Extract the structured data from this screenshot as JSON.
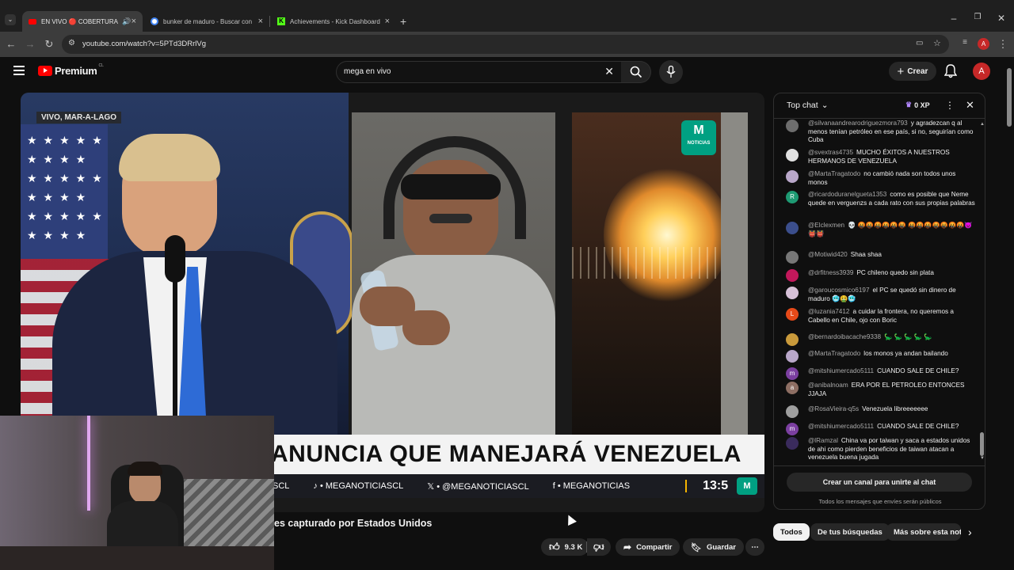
{
  "browser": {
    "tabs": [
      {
        "label": "EN VIVO 🔴 COBERTURA E",
        "active": true
      },
      {
        "label": "bunker de maduro - Buscar con"
      },
      {
        "label": "Achievements - Kick Dashboard"
      }
    ],
    "url": "youtube.com/watch?v=5PTd3DRrlVg",
    "profile_initial": "A"
  },
  "yt": {
    "logo_text": "Premium",
    "region": "CL",
    "search_value": "mega en vivo",
    "create_label": "Crear",
    "avatar_initial": "A"
  },
  "video": {
    "location_tag": "VIVO, MAR-A-LAGO",
    "brand": "NOTICIAS",
    "headline": "ANUNCIA QUE MANEJARÁ VENEZUELA",
    "ticker": [
      "SCL",
      "MEGANOTICIASCL",
      "@MEGANOTICIASCL",
      "MEGANOTICIAS"
    ],
    "time": "13:5"
  },
  "title": "es capturado por Estados Unidos",
  "actions": {
    "likes": "9.3 K",
    "share": "Compartir",
    "save": "Guardar"
  },
  "chat": {
    "header": "Top chat",
    "xp": "0 XP",
    "messages": [
      {
        "author": "@silvanaandrearodriguezmora793",
        "text": "y agradezcan q al menos tenían petróleo en ese país, si no, seguirían como Cuba",
        "av": "",
        "color": "#6d6d6d"
      },
      {
        "author": "@svextras4735",
        "text": "MUCHO ÉXITOS A NUESTROS HERMANOS DE VENEZUELA",
        "av": "",
        "color": "#e0e0e0"
      },
      {
        "author": "@MartaTragatodo",
        "text": "no cambió nada son todos unos monos",
        "av": "",
        "color": "#b9a7c9"
      },
      {
        "author": "@ricardoduranelgueta1353",
        "text": "como es posible que Neme quede en verguenzs a cada rato con sus propias palabras",
        "av": "R",
        "color": "#1e9a73"
      },
      {
        "author": "@Elclexmen",
        "text": "💀 🤬🤬🤬🤬🤬🤬 🤬🤬🤬🤬🤬🤬🤬😈👹👹",
        "av": "",
        "color": "#3b4e8c"
      },
      {
        "author": "@Motiwid420",
        "text": "Shaa shaa",
        "av": "",
        "color": "#777"
      },
      {
        "author": "@drfitness3939",
        "text": "PC chileno quedo sin plata",
        "av": "",
        "color": "#c2185b"
      },
      {
        "author": "@garoucosmico6197",
        "text": "el PC se quedó sin dinero de maduro 🥶🤮🥶",
        "av": "",
        "color": "#d7c1d8"
      },
      {
        "author": "@luzania7412",
        "text": "a cuidar la frontera, no queremos a Cabello en Chile, ojo con Boric",
        "av": "L",
        "color": "#e64a19"
      },
      {
        "author": "@bernardoibacache9338",
        "text": "🦕 🦕 🦕 🦕 🦕",
        "av": "",
        "color": "#c99a3b"
      },
      {
        "author": "@MartaTragatodo",
        "text": "los monos ya andan bailando",
        "av": "",
        "color": "#b9a7c9"
      },
      {
        "author": "@mitshiumercado5111",
        "text": "CUANDO SALE DE CHILE?",
        "av": "m",
        "color": "#7b3fa0"
      },
      {
        "author": "@anibalnoam",
        "text": "ERA POR EL PETROLEO ENTONCES JJAJA",
        "av": "a",
        "color": "#8d6e63"
      },
      {
        "author": "@RosaVieira-q5s",
        "text": "Venezuela libreeeeeee",
        "av": "",
        "color": "#9e9e9e"
      },
      {
        "author": "@mitshiumercado5111",
        "text": "CUANDO SALE DE CHILE?",
        "av": "m",
        "color": "#7b3fa0"
      },
      {
        "author": "@lRamzal",
        "text": "China va por taiwan y saca a estados unidos de ahi como pierden beneficios de taiwan atacan a venezuela buena jugada",
        "av": "",
        "color": "#3a2b5c"
      }
    ],
    "join_label": "Crear un canal para unirte al chat",
    "footer_note": "Todos los mensajes que envíes serán públicos"
  },
  "filters": [
    "Todos",
    "De tus búsquedas",
    "Más sobre esta not"
  ]
}
